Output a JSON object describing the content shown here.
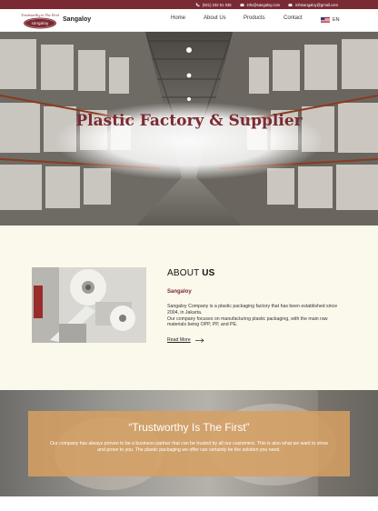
{
  "topbar": {
    "phone": "(021) 232 61 035",
    "email_info": "info@sangaloy.com",
    "email_gmail": "infosangaloy@gmail.com",
    "phone_icon": "phone-icon",
    "mail_icon": "mail-icon"
  },
  "navbar": {
    "logo_top_text": "Trustworthy is The First",
    "logo_text": "sangaloy",
    "brand": "Sangaloy",
    "items": [
      "Home",
      "About Us",
      "Products",
      "Contact"
    ],
    "language": "EN",
    "flag_icon": "us-flag-icon"
  },
  "hero": {
    "title": "Plastic Factory & Supplier"
  },
  "about": {
    "heading_prefix": "ABOUT",
    "heading_bold": "US",
    "company": "Sangaloy",
    "paragraph1": "Sangaloy Company is a plastic packaging factory that has been established since 2004, in Jakarta.",
    "paragraph2": "Our company focuses on manufacturing plastic packaging, with the main raw materials being OPP, PP, and PE.",
    "read_more": "Read More",
    "arrow_icon": "arrow-right-icon"
  },
  "trust": {
    "title": "“Trustworthy Is The First”",
    "text": "Our company has always proven to be a business partner that can be trusted by all our customers. This is also what we want to show and prove to you. The plastic packaging we offer can certainly be the solution you need."
  },
  "colors": {
    "brand_maroon": "#7a2a33",
    "about_bg": "#fbf8ec",
    "trust_box": "#d6a062"
  }
}
